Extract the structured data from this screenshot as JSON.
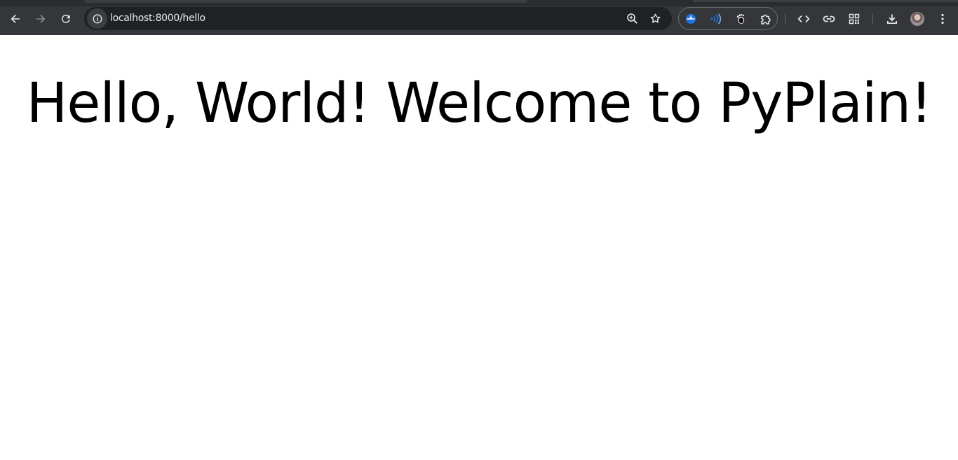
{
  "browser": {
    "url_host": "localhost",
    "url_rest": ":8000/hello",
    "icons": {
      "back": "arrow-left-icon",
      "forward": "arrow-right-icon",
      "reload": "reload-icon",
      "site_info": "info-icon",
      "zoom": "zoom-in-icon",
      "bookmark": "star-icon",
      "extension_1": "blue-compass-extension-icon",
      "extension_2": "signal-waves-extension-icon",
      "extension_3": "gnome-foot-extension-icon",
      "extensions_menu": "puzzle-piece-icon",
      "devtools": "code-brackets-icon",
      "copy_link": "link-icon",
      "qr_code": "qr-code-icon",
      "downloads": "download-icon",
      "profile": "avatar",
      "menu": "kebab-menu-icon"
    },
    "colors": {
      "toolbar": "#35363a",
      "omnibox": "#202124",
      "icon": "#e8eaed",
      "extension_blue": "#1a73e8"
    }
  },
  "page": {
    "heading": "Hello, World! Welcome to PyPlain!"
  }
}
